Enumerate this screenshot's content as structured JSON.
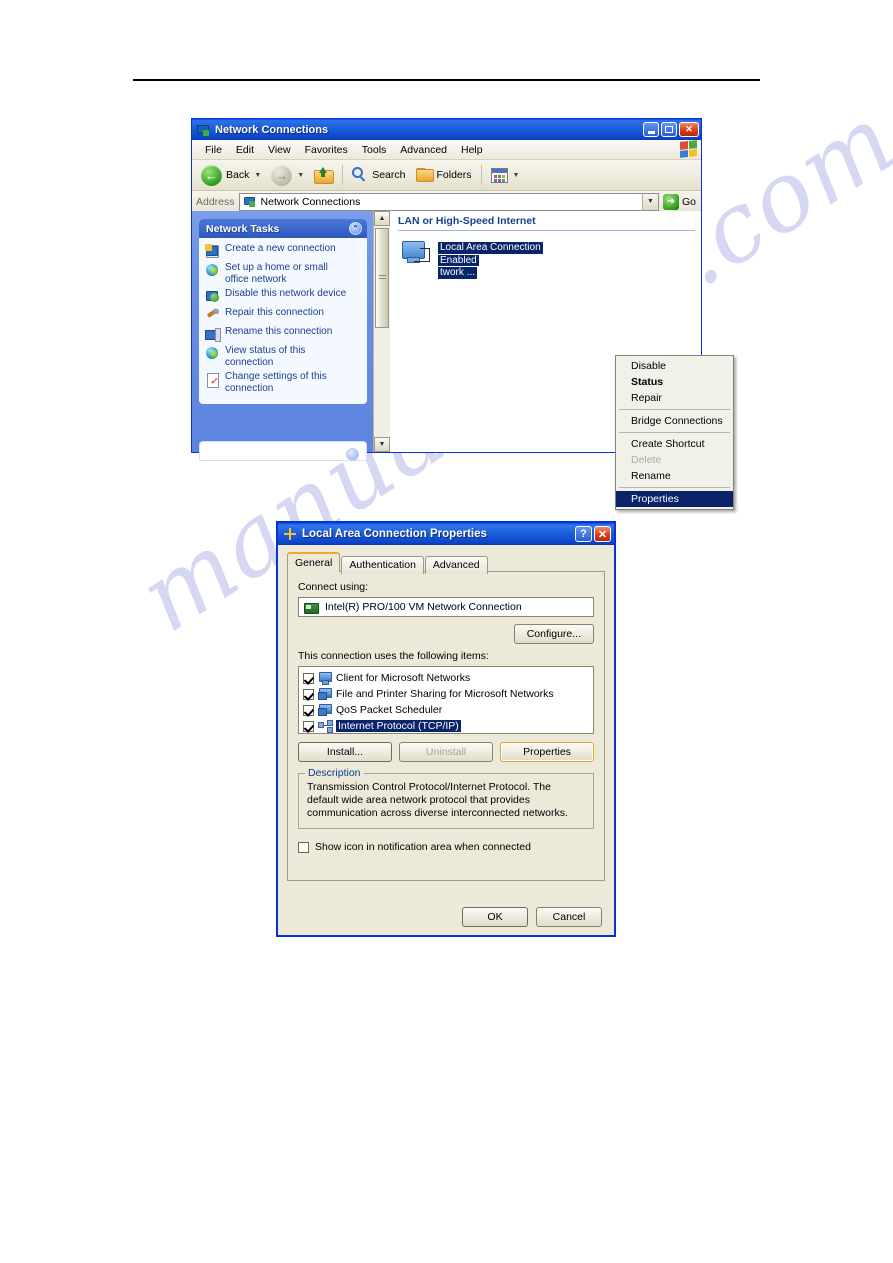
{
  "page": {
    "watermark": "manualshive.com"
  },
  "explorer": {
    "title": "Network Connections",
    "title_icon": "network-connections-icon",
    "window_buttons": {
      "minimize": "_",
      "maximize": "□",
      "close": "✕"
    },
    "menu": [
      "File",
      "Edit",
      "View",
      "Favorites",
      "Tools",
      "Advanced",
      "Help"
    ],
    "toolbar": {
      "back": "Back",
      "forward": "",
      "up": "",
      "search": "Search",
      "folders": "Folders",
      "views": ""
    },
    "address": {
      "label": "Address",
      "value": "Network Connections",
      "go": "Go"
    },
    "sidebar": {
      "panel_title": "Network Tasks",
      "collapse_glyph": "⌃",
      "items": [
        {
          "label": "Create a new connection",
          "icon": "new-connection-icon"
        },
        {
          "label": "Set up a home or small office network",
          "icon": "home-network-icon"
        },
        {
          "label": "Disable this network device",
          "icon": "disable-device-icon"
        },
        {
          "label": "Repair this connection",
          "icon": "repair-icon"
        },
        {
          "label": "Rename this connection",
          "icon": "rename-icon"
        },
        {
          "label": "View status of this connection",
          "icon": "status-icon"
        },
        {
          "label": "Change settings of this connection",
          "icon": "settings-icon"
        }
      ]
    },
    "content": {
      "group_header": "LAN or High-Speed Internet",
      "connection": {
        "name": "Local Area Connection",
        "status": "Enabled",
        "device": "twork ..."
      }
    },
    "context_menu": [
      {
        "label": "Disable",
        "style": "normal"
      },
      {
        "label": "Status",
        "style": "bold"
      },
      {
        "label": "Repair",
        "style": "normal"
      },
      {
        "separator": true
      },
      {
        "label": "Bridge Connections",
        "style": "normal"
      },
      {
        "separator": true
      },
      {
        "label": "Create Shortcut",
        "style": "normal"
      },
      {
        "label": "Delete",
        "style": "disabled"
      },
      {
        "label": "Rename",
        "style": "normal"
      },
      {
        "separator": true
      },
      {
        "label": "Properties",
        "style": "selected"
      }
    ]
  },
  "dialog": {
    "title": "Local Area Connection Properties",
    "title_icon": "connection-properties-icon",
    "help_button": "?",
    "close_button": "✕",
    "tabs": [
      {
        "label": "General",
        "active": true
      },
      {
        "label": "Authentication",
        "active": false
      },
      {
        "label": "Advanced",
        "active": false
      }
    ],
    "connect_using_label": "Connect using:",
    "adapter": "Intel(R) PRO/100 VM Network Connection",
    "configure_button": "Configure...",
    "items_label": "This connection uses the following items:",
    "items": [
      {
        "label": "Client for Microsoft Networks",
        "checked": true,
        "selected": false,
        "icon": "client-icon"
      },
      {
        "label": "File and Printer Sharing for Microsoft Networks",
        "checked": true,
        "selected": false,
        "icon": "sharing-icon"
      },
      {
        "label": "QoS Packet Scheduler",
        "checked": true,
        "selected": false,
        "icon": "qos-icon"
      },
      {
        "label": "Internet Protocol (TCP/IP)",
        "checked": true,
        "selected": true,
        "icon": "protocol-icon"
      }
    ],
    "buttons": {
      "install": "Install...",
      "uninstall": "Uninstall",
      "properties": "Properties"
    },
    "description_legend": "Description",
    "description_text": "Transmission Control Protocol/Internet Protocol. The default wide area network protocol that provides communication across diverse interconnected networks.",
    "show_icon_checkbox": {
      "label": "Show icon in notification area when connected",
      "checked": false
    },
    "footer": {
      "ok": "OK",
      "cancel": "Cancel"
    }
  }
}
